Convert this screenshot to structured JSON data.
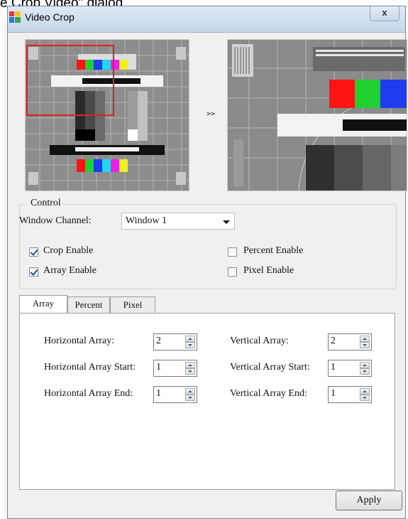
{
  "caption": "e Crop Video\" dialog",
  "window": {
    "title": "Video Crop",
    "close_label": "x"
  },
  "preview": {
    "arrow_label": ">>"
  },
  "control": {
    "legend": "Control",
    "window_channel_label": "Window Channel:",
    "window_channel_value": "Window 1",
    "checkboxes": [
      {
        "label": "Crop Enable",
        "checked": true
      },
      {
        "label": "Array Enable",
        "checked": true
      },
      {
        "label": "Percent Enable",
        "checked": false
      },
      {
        "label": "Pixel Enable",
        "checked": false
      }
    ]
  },
  "tabs": [
    {
      "label": "Array",
      "active": true
    },
    {
      "label": "Percent",
      "active": false
    },
    {
      "label": "Pixel",
      "active": false
    }
  ],
  "array_panel": {
    "fields": [
      {
        "label": "Horizontal Array:",
        "value": "2"
      },
      {
        "label": "Horizontal Array Start:",
        "value": "1"
      },
      {
        "label": "Horizontal Array End:",
        "value": "1"
      },
      {
        "label": "Vertical Array:",
        "value": "2"
      },
      {
        "label": "Vertical Array Start:",
        "value": "1"
      },
      {
        "label": "Vertical Array End:",
        "value": "1"
      }
    ]
  },
  "apply_label": "Apply",
  "colors": {
    "crop_rect": "#e02020",
    "accent": "#1d4fa3"
  }
}
